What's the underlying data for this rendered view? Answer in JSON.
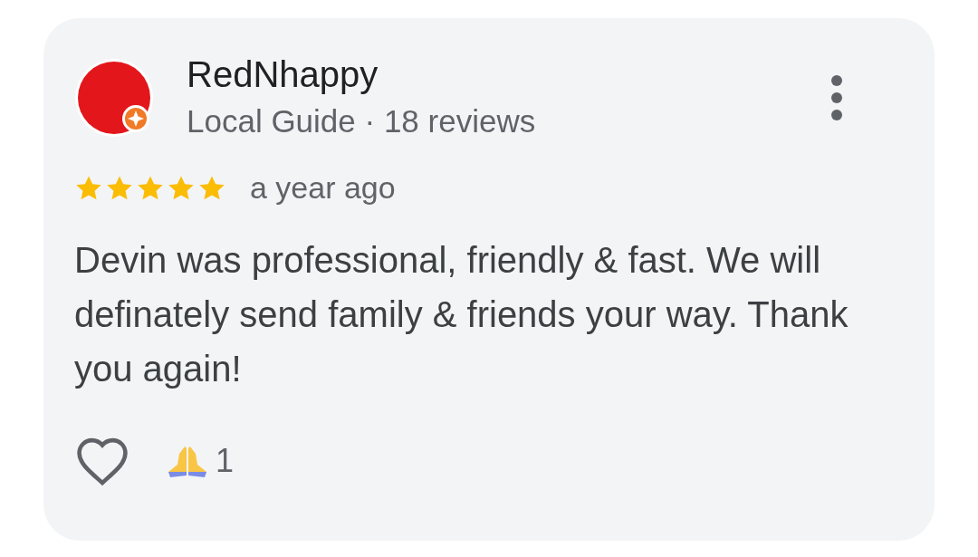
{
  "review": {
    "author": "RedNhappy",
    "subtitle": "Local Guide · 18 reviews",
    "stars": 5,
    "time": "a year ago",
    "text": "Devin was professional, friendly & fast. We will definately send family & friends your way. Thank you again!",
    "reactions": [
      {
        "kind": "like",
        "selected": false
      },
      {
        "kind": "pray",
        "count": "1"
      }
    ]
  }
}
